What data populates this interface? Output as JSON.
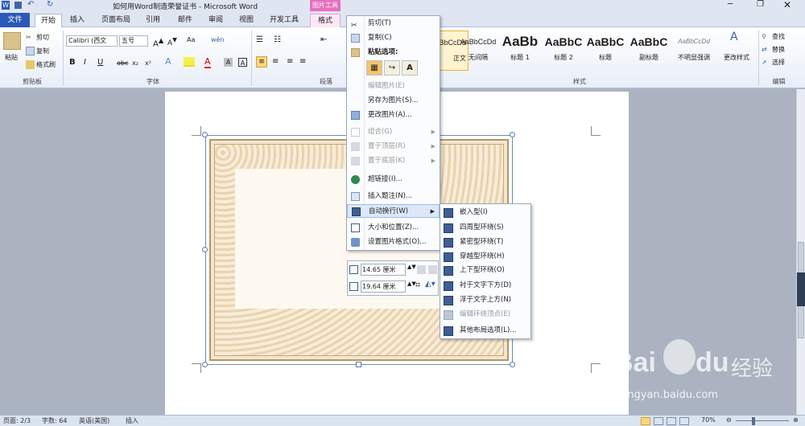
{
  "window": {
    "title": "如何用Word制造荣誉证书 - Microsoft Word",
    "contextual_tab_group": "图片工具"
  },
  "tabs": {
    "file": "文件",
    "home": "开始",
    "insert": "插入",
    "layout": "页面布局",
    "references": "引用",
    "mailings": "邮件",
    "review": "审阅",
    "view": "视图",
    "developer": "开发工具",
    "format": "格式"
  },
  "clipboard": {
    "paste": "粘贴",
    "cut": "剪切",
    "copy": "复制",
    "format_painter": "格式刷",
    "label": "剪贴板"
  },
  "font": {
    "name": "Calibri (西文",
    "size": "五号",
    "aa": "Aa",
    "label": "字体",
    "bold": "B",
    "italic": "I",
    "underline": "U",
    "strike": "abc",
    "sub": "x₂",
    "sup": "x²",
    "color_a": "A",
    "wen": "wén"
  },
  "paragraph": {
    "label": "段落"
  },
  "styles": {
    "label": "样式",
    "items": [
      {
        "sample": "AaBbCcDd",
        "name": "正文"
      },
      {
        "sample": "AaBbCcDd",
        "name": "无间隔"
      },
      {
        "sample": "AaBb",
        "name": "标题 1"
      },
      {
        "sample": "AaBbC",
        "name": "标题 2"
      },
      {
        "sample": "AaBbC",
        "name": "标题"
      },
      {
        "sample": "AaBbC",
        "name": "副标题"
      },
      {
        "sample": "AaBbCcDd",
        "name": "不明显强调"
      }
    ],
    "change_styles": "更改样式"
  },
  "editing": {
    "find": "查找",
    "replace": "替换",
    "select": "选择",
    "label": "编辑"
  },
  "context_menu": {
    "cut": "剪切(T)",
    "copy": "复制(C)",
    "paste_options": "粘贴选项:",
    "edit_picture": "编辑图片(E)",
    "save_as_picture": "另存为图片(S)...",
    "change_picture": "更改图片(A)...",
    "group": "组合(G)",
    "bring_front": "置于顶层(R)",
    "send_back": "置于底层(K)",
    "hyperlink": "超链接(I)...",
    "insert_caption": "插入题注(N)...",
    "wrap_text": "自动换行(W)",
    "size_position": "大小和位置(Z)...",
    "format_picture": "设置图片格式(O)..."
  },
  "wrap_submenu": {
    "inline": "嵌入型(I)",
    "square": "四周型环绕(S)",
    "tight": "紧密型环绕(T)",
    "through": "穿越型环绕(H)",
    "top_bottom": "上下型环绕(O)",
    "behind": "衬于文字下方(D)",
    "in_front": "浮于文字上方(N)",
    "edit_wrap_points": "编辑环绕顶点(E)",
    "more_options": "其他布局选项(L)..."
  },
  "mini_toolbar": {
    "height": "14.65 厘米",
    "width": "19.64 厘米"
  },
  "statusbar": {
    "page": "页面: 2/3",
    "words": "字数: 64",
    "language": "英语(美国)",
    "mode": "插入",
    "zoom": "70%"
  },
  "watermark": {
    "brand": "Bai",
    "brand2": "du",
    "cn": "经验",
    "url": "jingyan.baidu.com"
  },
  "colors": {
    "file_tab": "#2a5ab5",
    "picture_tools": "#e86fc0",
    "accent_select": "#6b8ab8"
  }
}
